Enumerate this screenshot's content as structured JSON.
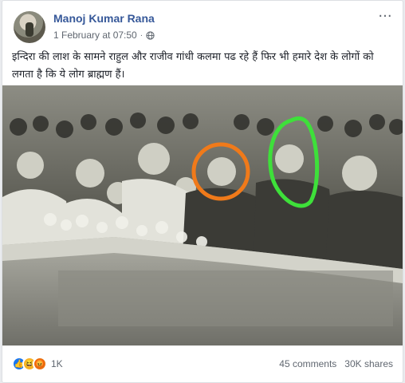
{
  "post": {
    "author": "Manoj Kumar Rana",
    "timestamp": "1 February at 07:50",
    "separator": "·",
    "privacy_icon": "globe-icon",
    "more_icon": "more-options-icon",
    "text": "इन्दिरा की लाश के सामने राहुल और राजीव गांधी कलमा पढ रहे हैं फिर भी हमारे देश के लोगों को लगता है कि ये लोग ब्राह्मण हैं।"
  },
  "stats": {
    "reactions": [
      "like-icon",
      "haha-icon",
      "angry-icon"
    ],
    "reaction_count": "1K",
    "comments": "45 comments",
    "shares": "30K shares"
  },
  "colors": {
    "link": "#365899",
    "meta": "#606770",
    "text": "#1d2129",
    "highlight_orange": "#f07a1a",
    "highlight_green": "#3ee03a"
  }
}
